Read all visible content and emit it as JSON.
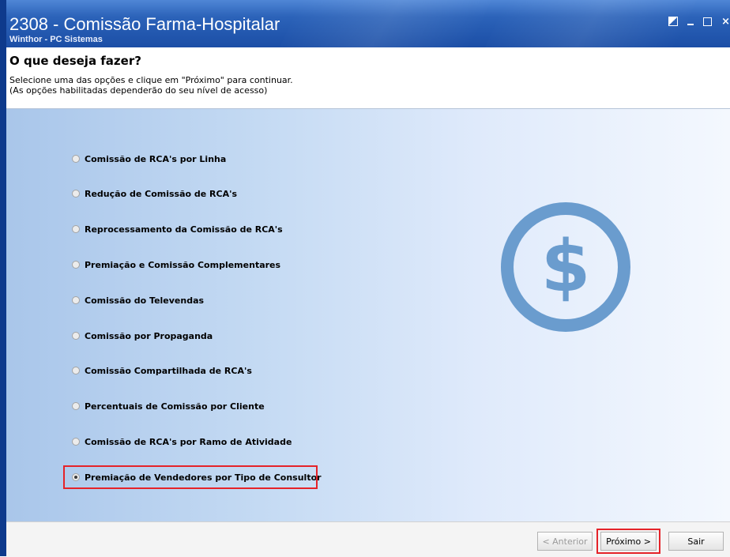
{
  "window": {
    "title": "2308 - Comissão Farma-Hospitalar",
    "subtitle": "Winthor - PC Sistemas",
    "controls": [
      "restore-icon",
      "minimize-icon",
      "maximize-icon",
      "close-icon"
    ],
    "close_glyph": "×"
  },
  "header": {
    "heading": "O que deseja fazer?",
    "line1": "Selecione uma das opções e clique em \"Próximo\" para continuar.",
    "line2": "(As opções habilitadas dependerão do seu nível de acesso)"
  },
  "options": [
    {
      "label": "Comissão de RCA's por Linha",
      "checked": false
    },
    {
      "label": "Redução de Comissão de RCA's",
      "checked": false
    },
    {
      "label": "Reprocessamento da Comissão de RCA's",
      "checked": false
    },
    {
      "label": "Premiação e Comissão Complementares",
      "checked": false
    },
    {
      "label": "Comissão do Televendas",
      "checked": false
    },
    {
      "label": "Comissão por Propaganda",
      "checked": false
    },
    {
      "label": "Comissão Compartilhada de RCA's",
      "checked": false
    },
    {
      "label": "Percentuais de Comissão por Cliente",
      "checked": false
    },
    {
      "label": "Comissão de RCA's por Ramo de Atividade",
      "checked": false
    },
    {
      "label": "Premiação de Vendedores por Tipo de Consultor",
      "checked": true
    }
  ],
  "illustration": {
    "icon": "dollar-coin-icon",
    "glyph": "$",
    "color": "#6a9cce"
  },
  "footer": {
    "back_label": "< Anterior",
    "next_label": "Próximo >",
    "exit_label": "Sair"
  },
  "colors": {
    "titlebar": "#1b4ea6",
    "highlight": "#e52329"
  }
}
